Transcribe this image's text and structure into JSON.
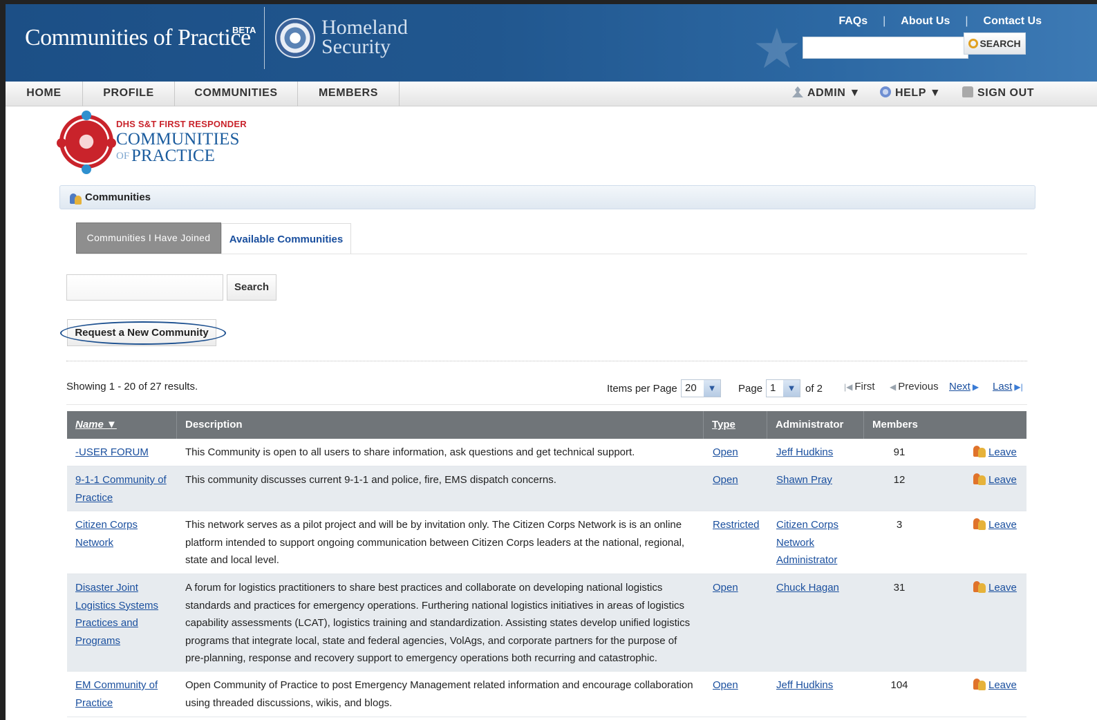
{
  "header": {
    "site_title": "Communities of Practice",
    "beta_badge": "BETA",
    "agency_line1": "Homeland",
    "agency_line2": "Security",
    "links": [
      "FAQs",
      "About Us",
      "Contact Us"
    ],
    "search_button": "SEARCH",
    "search_value": ""
  },
  "nav": {
    "home": "HOME",
    "profile": "PROFILE",
    "communities": "COMMUNITIES",
    "members": "MEMBERS",
    "admin": "ADMIN ▼",
    "help": "HELP ▼",
    "signout": "SIGN OUT"
  },
  "logo": {
    "kicker": "DHS S&T FIRST RESPONDER",
    "line1": "COMMUNITIES",
    "line2_of": "OF",
    "line2": "PRACTICE"
  },
  "section": {
    "title": "Communities"
  },
  "tabs": {
    "joined": "Communities I Have Joined",
    "available": "Available Communities"
  },
  "search": {
    "value": "",
    "button": "Search"
  },
  "request_button": "Request a New Community",
  "pager": {
    "showing": "Showing 1 - 20 of 27 results.",
    "items_per_page_label": "Items per Page",
    "items_per_page": "20",
    "page_label": "Page",
    "page": "1",
    "of_pages": "of 2",
    "first": "First",
    "previous": "Previous",
    "next": "Next",
    "last": "Last"
  },
  "table": {
    "headers": {
      "name": "Name ▼",
      "description": "Description",
      "type": "Type",
      "administrator": "Administrator",
      "members": "Members"
    },
    "rows": [
      {
        "name": "-USER FORUM",
        "description": "This Community is open to all users to share information, ask questions and get technical support.",
        "type": "Open",
        "administrator": "Jeff Hudkins",
        "members": "91",
        "action": "Leave"
      },
      {
        "name": "9-1-1 Community of Practice",
        "description": "This community discusses current 9-1-1 and police, fire, EMS dispatch concerns.",
        "type": "Open",
        "administrator": "Shawn Pray",
        "members": "12",
        "action": "Leave"
      },
      {
        "name": "Citizen Corps Network",
        "description": "This network serves as a pilot project and will be by invitation only. The Citizen Corps Network is is an online platform intended to support ongoing communication between Citizen Corps leaders at the national, regional, state and local level.",
        "type": "Restricted",
        "administrator": "Citizen Corps Network Administrator",
        "members": "3",
        "action": "Leave"
      },
      {
        "name": "Disaster Joint Logistics Systems Practices and Programs",
        "description": "A forum for logistics practitioners to share best practices and collaborate on developing national logistics standards and practices for emergency operations. Furthering national logistics initiatives in areas of logistics capability assessments (LCAT), logistics training and standardization. Assisting states develop unified logistics programs that integrate local, state and federal agencies, VolAgs, and corporate partners for the purpose of pre-planning, response and recovery support to emergency operations both recurring and catastrophic.",
        "type": "Open",
        "administrator": "Chuck Hagan",
        "members": "31",
        "action": "Leave"
      },
      {
        "name": "EM Community of Practice",
        "description": "Open Community of Practice to post Emergency Management related information and encourage collaboration using threaded discussions, wikis, and blogs.",
        "type": "Open",
        "administrator": "Jeff Hudkins",
        "members": "104",
        "action": "Leave"
      }
    ]
  }
}
